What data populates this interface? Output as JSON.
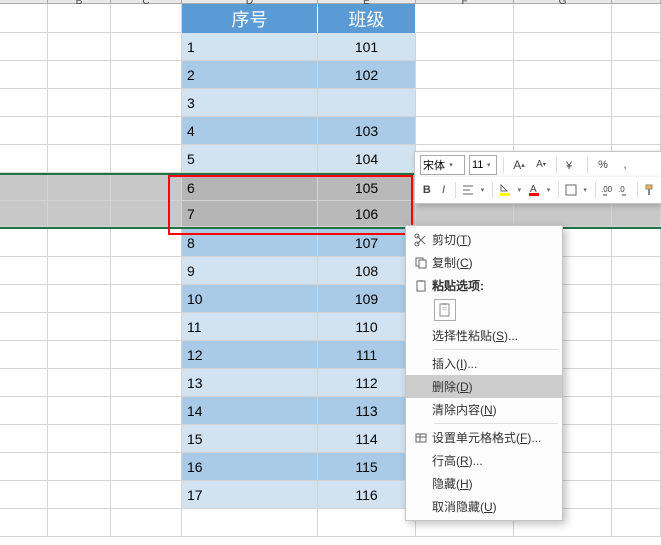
{
  "columns": [
    "B",
    "C",
    "D",
    "E",
    "F",
    "G"
  ],
  "table": {
    "headers": [
      "序号",
      "班级"
    ],
    "rows": [
      {
        "seq": "1",
        "cls": "101"
      },
      {
        "seq": "2",
        "cls": "102"
      },
      {
        "seq": "3",
        "cls": ""
      },
      {
        "seq": "4",
        "cls": "103"
      },
      {
        "seq": "5",
        "cls": "104"
      },
      {
        "seq": "6",
        "cls": "105"
      },
      {
        "seq": "7",
        "cls": "106"
      },
      {
        "seq": "8",
        "cls": "107"
      },
      {
        "seq": "9",
        "cls": "108"
      },
      {
        "seq": "10",
        "cls": "109"
      },
      {
        "seq": "11",
        "cls": "110"
      },
      {
        "seq": "12",
        "cls": "111"
      },
      {
        "seq": "13",
        "cls": "112"
      },
      {
        "seq": "14",
        "cls": "113"
      },
      {
        "seq": "15",
        "cls": "114"
      },
      {
        "seq": "16",
        "cls": "115"
      },
      {
        "seq": "17",
        "cls": "116"
      }
    ]
  },
  "mini_toolbar": {
    "font_name": "宋体",
    "font_size": "11",
    "percent": "%",
    "comma": ","
  },
  "context_menu": {
    "cut": "剪切(T)",
    "copy": "复制(C)",
    "paste_options": "粘贴选项:",
    "paste_special": "选择性粘贴(S)...",
    "insert": "插入(I)...",
    "delete": "删除(D)",
    "clear": "清除内容(N)",
    "format": "设置单元格格式(F)...",
    "row_height": "行高(R)...",
    "hide": "隐藏(H)",
    "unhide": "取消隐藏(U)"
  }
}
